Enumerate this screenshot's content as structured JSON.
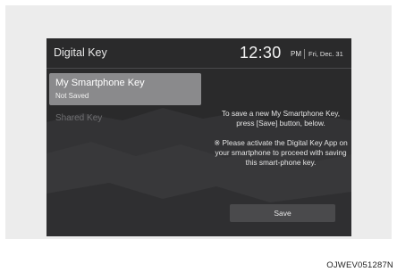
{
  "header": {
    "app_title": "Digital Key",
    "time": "12:30",
    "ampm": "PM",
    "date": "Fri, Dec. 31"
  },
  "menu": {
    "items": [
      {
        "label": "My Smartphone Key",
        "sub": "Not Saved"
      },
      {
        "label": "Shared Key"
      }
    ]
  },
  "content": {
    "instruction": "To save a new My Smartphone Key, press [Save] button, below.",
    "note": "※ Please activate the Digital Key App on your smartphone to proceed with saving this smart-phone key.",
    "save_label": "Save"
  },
  "caption": "OJWEV051287N"
}
